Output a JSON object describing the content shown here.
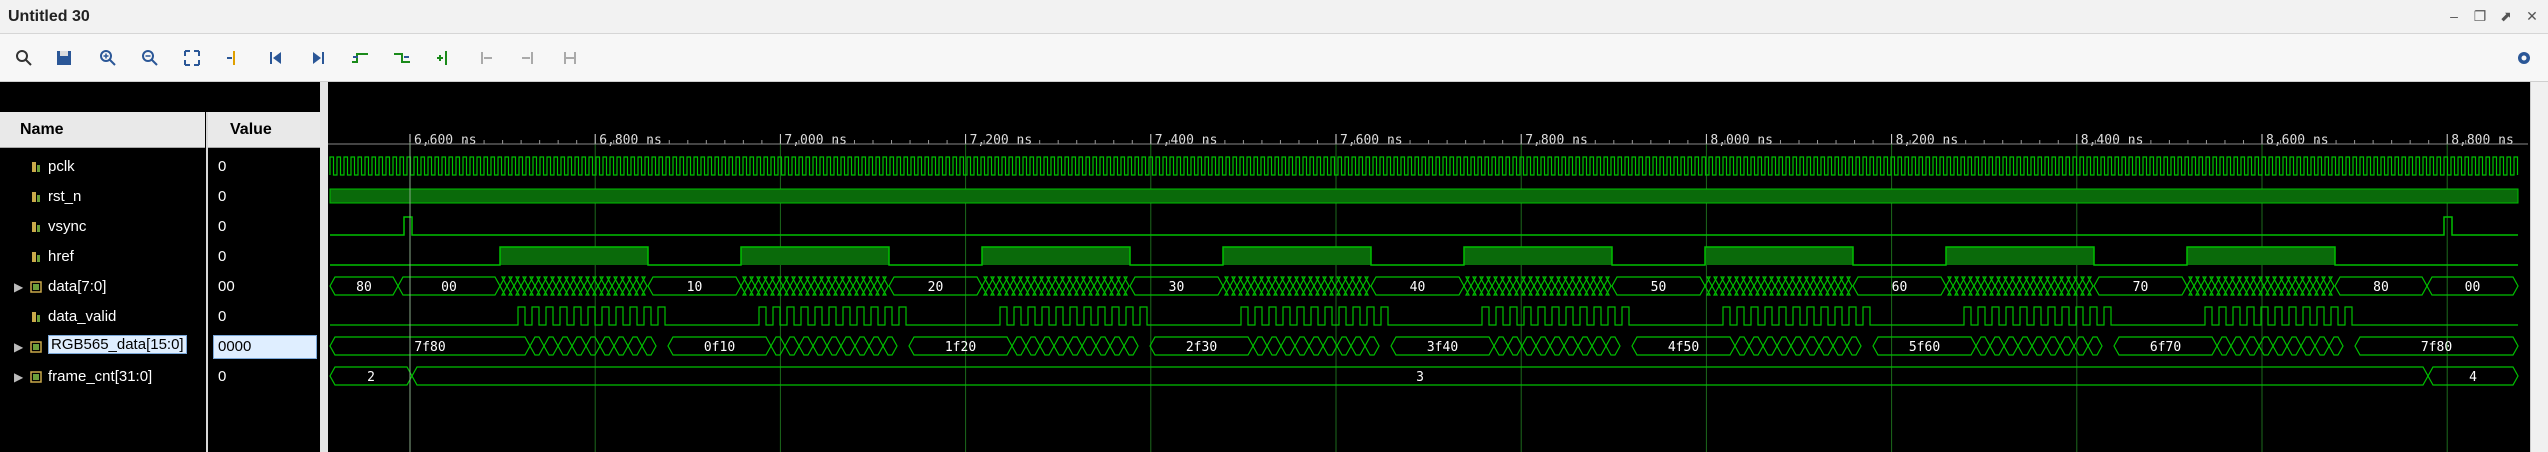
{
  "window": {
    "title": "Untitled 30"
  },
  "columns": {
    "name": "Name",
    "value": "Value"
  },
  "signals": [
    {
      "name": "pclk",
      "value": "0",
      "expandable": false,
      "kind": "bit"
    },
    {
      "name": "rst_n",
      "value": "0",
      "expandable": false,
      "kind": "bit"
    },
    {
      "name": "vsync",
      "value": "0",
      "expandable": false,
      "kind": "bit"
    },
    {
      "name": "href",
      "value": "0",
      "expandable": false,
      "kind": "bit"
    },
    {
      "name": "data[7:0]",
      "value": "00",
      "expandable": true,
      "kind": "bus"
    },
    {
      "name": "data_valid",
      "value": "0",
      "expandable": false,
      "kind": "bit"
    },
    {
      "name": "RGB565_data[15:0]",
      "value": "0000",
      "expandable": true,
      "kind": "bus",
      "selected": true
    },
    {
      "name": "frame_cnt[31:0]",
      "value": "0",
      "expandable": true,
      "kind": "bus"
    }
  ],
  "timeline": {
    "ticks": [
      "6,600 ns",
      "6,800 ns",
      "7,000 ns",
      "7,200 ns",
      "7,400 ns",
      "7,600 ns",
      "7,800 ns",
      "8,000 ns",
      "8,200 ns",
      "8,400 ns",
      "8,600 ns",
      "8,800 ns"
    ]
  },
  "bus_labels": {
    "data": [
      "80",
      "00",
      "10",
      "20",
      "30",
      "40",
      "50",
      "60",
      "70",
      "80",
      "00"
    ],
    "rgb": [
      "7f80",
      "0f10",
      "1f20",
      "2f30",
      "3f40",
      "4f50",
      "5f60",
      "6f70",
      "7f80"
    ],
    "frame_cnt": [
      "2",
      "3",
      "4"
    ]
  },
  "colors": {
    "wave": "#00c000",
    "cursor": "#ffffff",
    "grid": "#1c6a1c"
  }
}
